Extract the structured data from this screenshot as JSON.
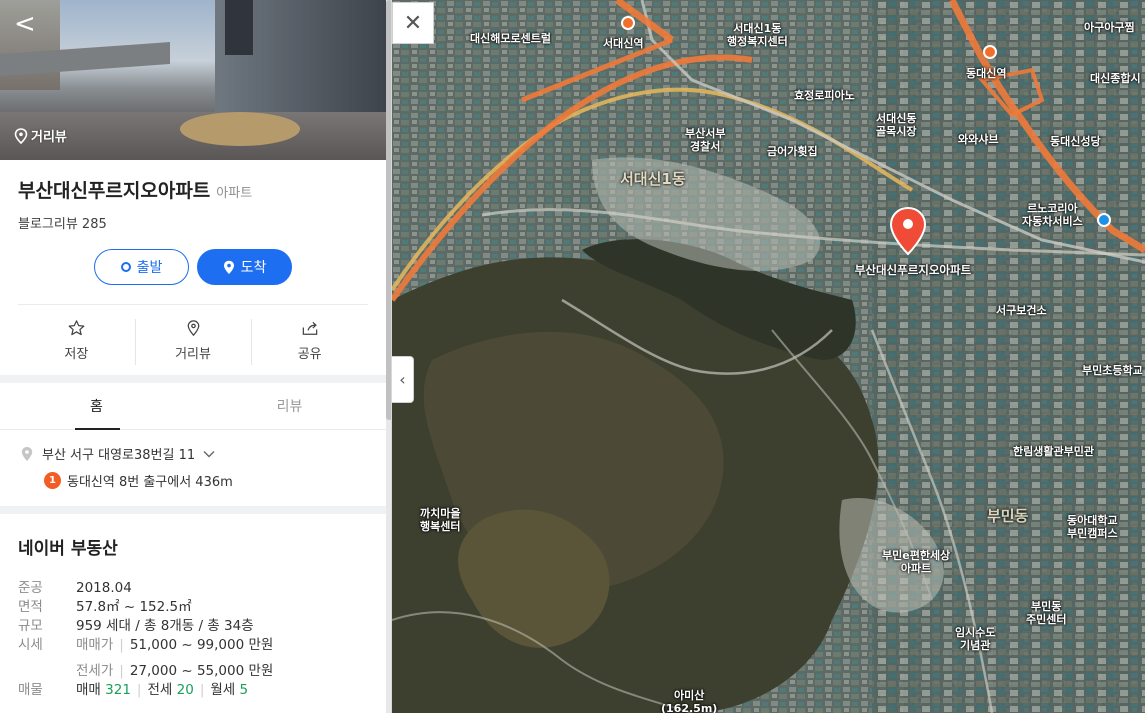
{
  "panel": {
    "back_label": "<",
    "streetview_label": "거리뷰",
    "title": "부산대신푸르지오아파트",
    "category": "아파트",
    "review": "블로그리뷰 285",
    "start_label": "출발",
    "arrive_label": "도착",
    "actions": [
      {
        "label": "저장",
        "icon": "star-icon"
      },
      {
        "label": "거리뷰",
        "icon": "pin-icon"
      },
      {
        "label": "공유",
        "icon": "share-icon"
      }
    ],
    "tabs": [
      "홈",
      "리뷰"
    ],
    "address": "부산 서구 대영로38번길 11",
    "station_badge": "1",
    "station_text": "동대신역 8번 출구에서 436m",
    "realty": {
      "heading": "네이버 부동산",
      "completion_key": "준공",
      "completion_val": "2018.04",
      "area_key": "면적",
      "area_val": "57.8㎡ ~ 152.5㎡",
      "scale_key": "규모",
      "scale_val": "959 세대 / 총 8개동 / 총 34층",
      "price_key": "시세",
      "sale_label": "매매가",
      "sale_val": "51,000 ~ 99,000 만원",
      "jeonse_label": "전세가",
      "jeonse_val": "27,000 ~ 55,000 만원",
      "listing_key": "매물",
      "listing_sale_label": "매매",
      "listing_sale_count": "321",
      "listing_jeonse_label": "전세",
      "listing_jeonse_count": "20",
      "listing_monthly_label": "월세",
      "listing_monthly_count": "5"
    }
  },
  "map": {
    "close_label": "✕",
    "collapse_label": "‹",
    "pin_label": "부산대신푸르지오아파트",
    "labels": [
      "대신해모로센트럴",
      "서대신역",
      "서대신1동\n행정복지센터",
      "동대신역",
      "아구아구찜",
      "대신종합시",
      "효정로피아노",
      "부산서부\n경찰서",
      "서대신동\n골목시장",
      "와와샤브",
      "동대신성당",
      "금어가휫집",
      "서대신1동",
      "르노코리아\n자동차서비스",
      "서구보건소",
      "부민초등학교",
      "한림생활관부민관",
      "까치마을\n행복센터",
      "부민동",
      "동아대학교\n부민캠퍼스",
      "부민e편한세상\n아파트",
      "부민동\n주민센터",
      "임시수도\n기념관",
      "아미산\n(162.5m)"
    ],
    "colors": {
      "accent": "#1e6ef2",
      "pin": "#ef4b36",
      "subway": "#f26f2b"
    }
  }
}
